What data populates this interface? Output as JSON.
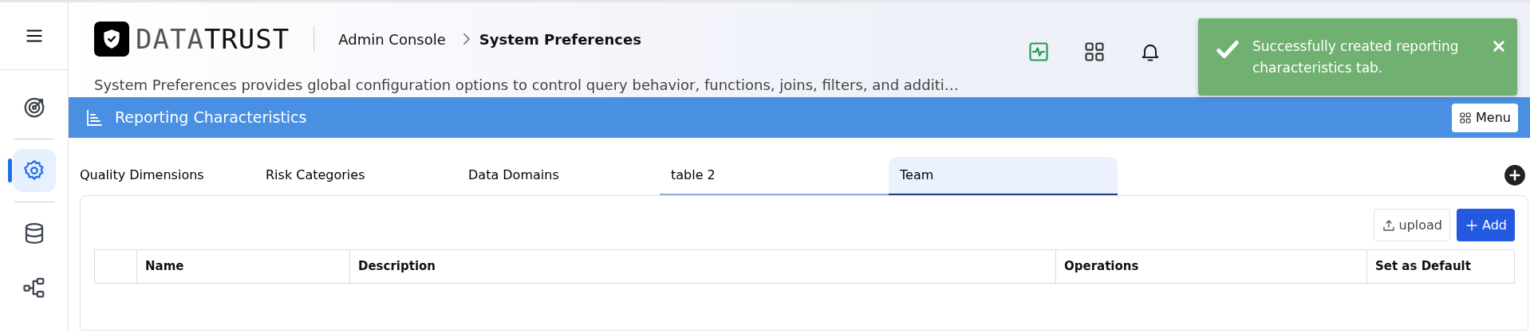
{
  "sidebar": {
    "items": [
      {
        "kind": "target",
        "selected": false
      },
      {
        "kind": "settings",
        "selected": true
      },
      {
        "kind": "database",
        "selected": false
      },
      {
        "kind": "hierarchy",
        "selected": false
      }
    ]
  },
  "header": {
    "logo": {
      "light": "DATA",
      "dark": "TRUST"
    },
    "breadcrumb": [
      {
        "label": "Admin Console",
        "current": false
      },
      {
        "label": "System Preferences",
        "current": true
      }
    ],
    "description": "System Preferences provides global configuration options to control query behavior, functions, joins, filters, and additi…"
  },
  "toast": {
    "message": "Successfully created reporting characteristics tab."
  },
  "section": {
    "title": "Reporting Characteristics",
    "menu_button": "Menu"
  },
  "tabs": [
    {
      "label": "Quality Dimensions",
      "selected": false,
      "underlined": false
    },
    {
      "label": "Risk Categories",
      "selected": false,
      "underlined": false
    },
    {
      "label": "Data Domains",
      "selected": false,
      "underlined": false
    },
    {
      "label": "table 2",
      "selected": false,
      "underlined": true
    },
    {
      "label": "Team",
      "selected": true,
      "underlined": true
    }
  ],
  "toolbar": {
    "upload": "upload",
    "add": "Add"
  },
  "table": {
    "columns": [
      "Name",
      "Description",
      "Operations",
      "Set as Default"
    ]
  }
}
